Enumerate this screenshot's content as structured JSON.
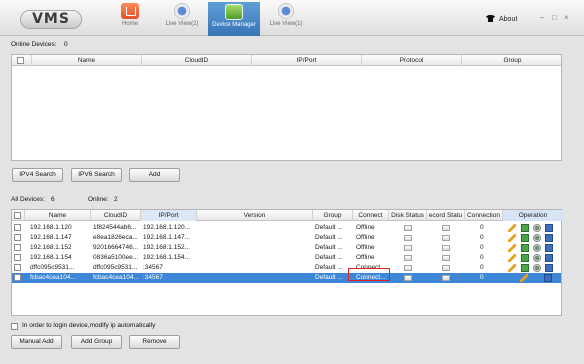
{
  "app": {
    "logo": "VMS"
  },
  "nav": [
    {
      "label": "Home",
      "icon": "home-icon"
    },
    {
      "label": "Live View(2)",
      "icon": "camera-icon"
    },
    {
      "label": "Device Manager",
      "icon": "device-manager-icon"
    },
    {
      "label": "Live View(1)",
      "icon": "camera-icon"
    }
  ],
  "window": {
    "about": "About",
    "minimize": "–",
    "maximize": "□",
    "close": "×"
  },
  "online": {
    "label": "Online Devices:",
    "count": "0",
    "columns": [
      "Name",
      "CloudID",
      "IP/Port",
      "Protocol",
      "Group"
    ]
  },
  "buttons": {
    "ipv4": "IPV4 Search",
    "ipv6": "IPV6 Search",
    "add": "Add",
    "manual_add": "Manual Add",
    "add_group": "Add Group",
    "remove": "Remove"
  },
  "all": {
    "label": "All Devices:",
    "count": "6",
    "online_label": "Online:",
    "online_count": "2",
    "columns": [
      "Name",
      "CloudID",
      "IP/Port",
      "Version",
      "Group",
      "Connect",
      "Disk Status",
      "ecord Statu",
      "Connection",
      "Operation"
    ],
    "rows": [
      {
        "name": "192.168.1.120",
        "cloud": "1f824544ab6...",
        "ip": "192.168.1.120...",
        "version": "",
        "group": "Default ...",
        "connect": "Offline",
        "connection": "0",
        "selected": false
      },
      {
        "name": "192.168.1.147",
        "cloud": "e8ea1826eca...",
        "ip": "192.168.1.147...",
        "version": "",
        "group": "Default ...",
        "connect": "Offline",
        "connection": "0",
        "selected": false
      },
      {
        "name": "192.168.1.152",
        "cloud": "92016664746...",
        "ip": "192.168.1.152...",
        "version": "",
        "group": "Default ...",
        "connect": "Offline",
        "connection": "0",
        "selected": false
      },
      {
        "name": "192.168.1.154",
        "cloud": "0836a5100ee...",
        "ip": "192.168.1.154...",
        "version": "",
        "group": "Default ...",
        "connect": "Offline",
        "connection": "0",
        "selected": false
      },
      {
        "name": "dffc095c9531...",
        "cloud": "dffc095c9531...",
        "ip": ":34567",
        "version": "",
        "group": "Default ...",
        "connect": "Connect...",
        "connection": "0",
        "selected": false
      },
      {
        "name": "fcbac4cea104...",
        "cloud": "fcbac4cea104...",
        "ip": ":34567",
        "version": "",
        "group": "Default ...",
        "connect": "Connect...",
        "connection": "0",
        "selected": true
      }
    ]
  },
  "checkbox_auto_ip": "In order to login device,modify ip automatically",
  "colors": {
    "accent": "#3e87d6",
    "highlight_box": "#e0201e"
  }
}
